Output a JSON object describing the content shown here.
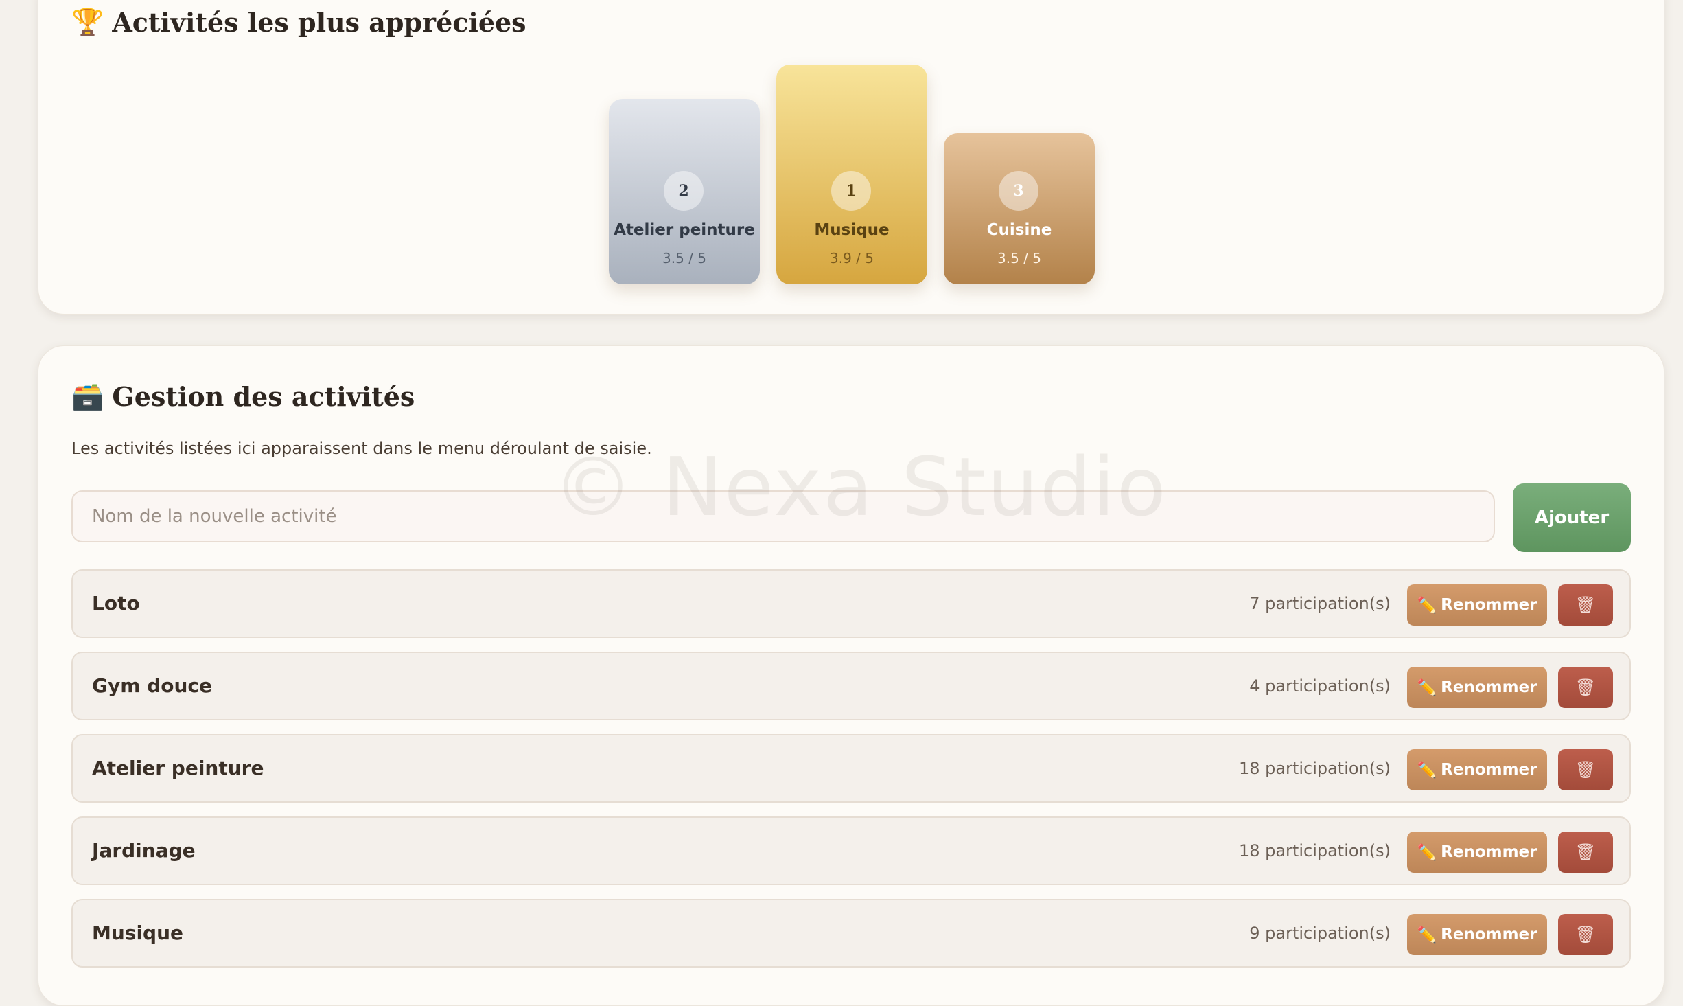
{
  "podium": {
    "icon": "trophy-icon",
    "title": "Activités les plus appréciées",
    "places": [
      {
        "rank": "2",
        "name": "Atelier peinture",
        "score": "3.5 / 5"
      },
      {
        "rank": "1",
        "name": "Musique",
        "score": "3.9 / 5"
      },
      {
        "rank": "3",
        "name": "Cuisine",
        "score": "3.5 / 5"
      }
    ]
  },
  "management": {
    "icon": "card-index-box-icon",
    "title": "Gestion des activités",
    "subtitle": "Les activités listées ici apparaissent dans le menu déroulant de saisie.",
    "new_activity_placeholder": "Nom de la nouvelle activité",
    "add_label": "Ajouter",
    "rename_label": "Renommer",
    "delete_icon": "wastebasket-icon",
    "rename_icon": "pencil-icon",
    "activities": [
      {
        "name": "Loto",
        "count": "7 participation(s)"
      },
      {
        "name": "Gym douce",
        "count": "4 participation(s)"
      },
      {
        "name": "Atelier peinture",
        "count": "18 participation(s)"
      },
      {
        "name": "Jardinage",
        "count": "18 participation(s)"
      },
      {
        "name": "Musique",
        "count": "9 participation(s)"
      }
    ]
  },
  "watermark": "© Nexa Studio",
  "colors": {
    "background": "#f4f1ec",
    "add_button": "#6a9f6b",
    "rename_button": "#c78f61",
    "delete_button": "#b05544",
    "gold": "#e0b24f",
    "silver": "#b8bfca",
    "bronze": "#c8965e"
  }
}
